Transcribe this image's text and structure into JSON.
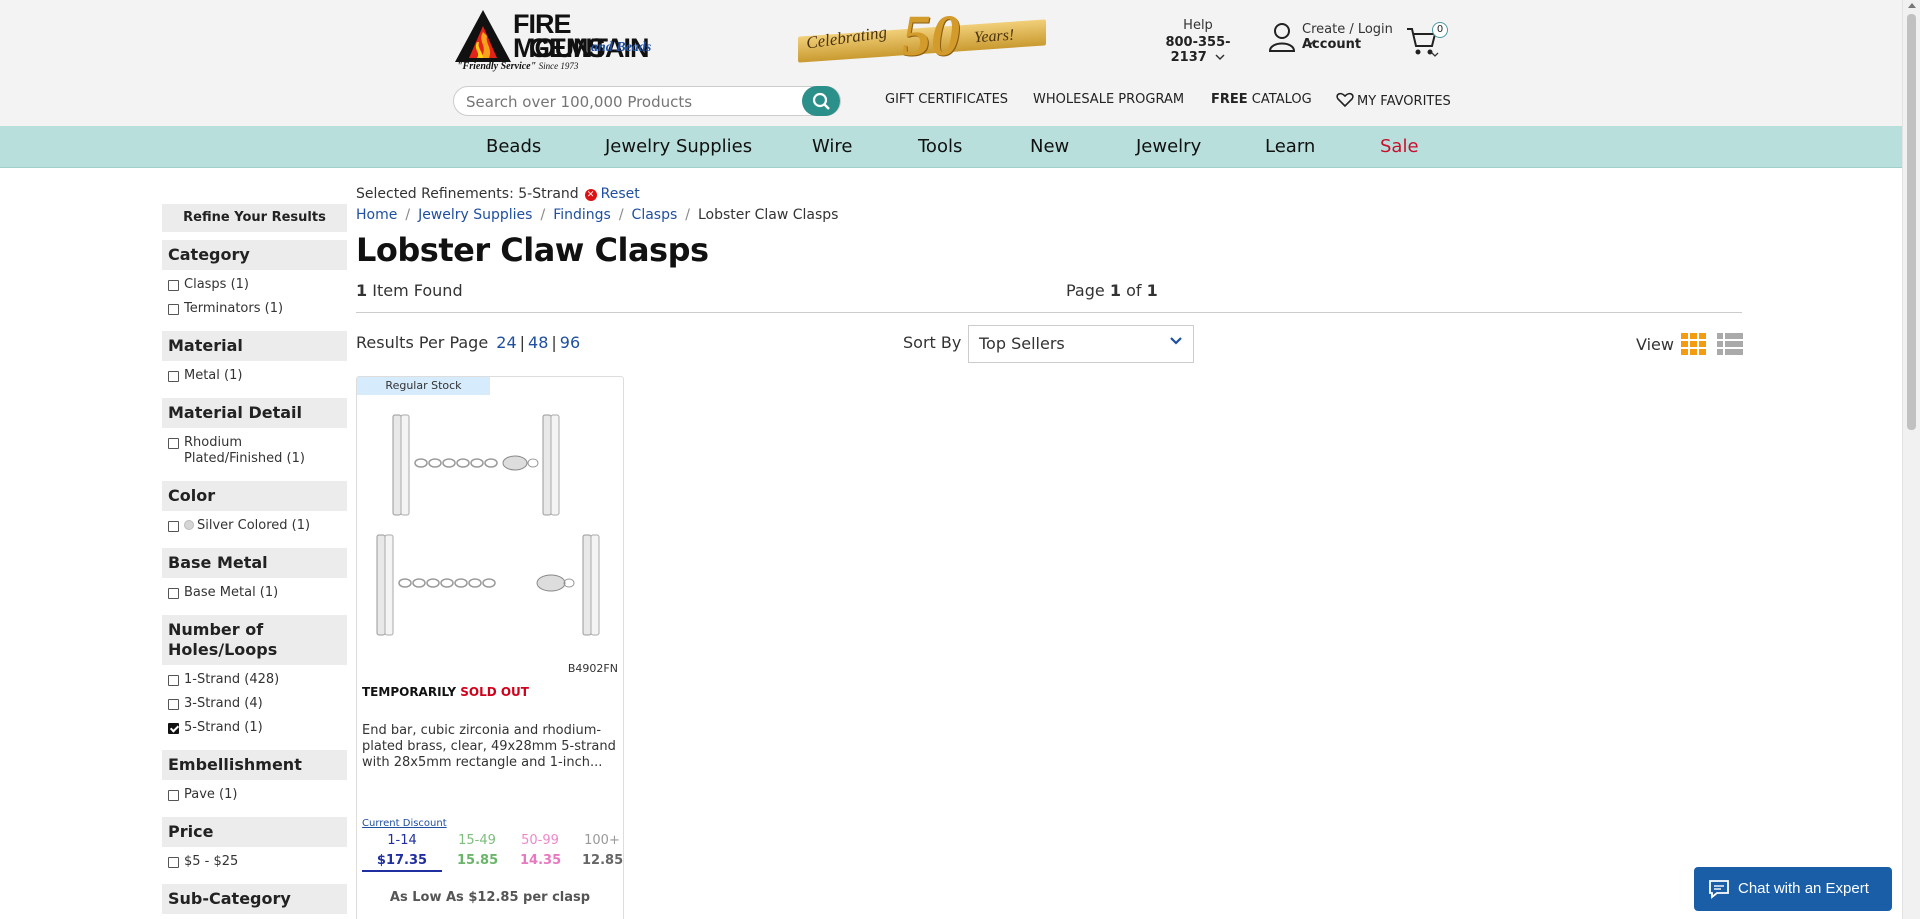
{
  "brand": {
    "name_line1": "FIRE MOUNTAIN",
    "name_line2": "GEMS",
    "name_beads": "and Beads",
    "tagline": "\"Friendly Service\"",
    "since": "Since 1973",
    "anniversary_left": "Celebrating",
    "anniversary_number": "50",
    "anniversary_right": "Years!"
  },
  "header": {
    "help_label": "Help",
    "phone": "800-355-2137",
    "account_line1": "Create / Login",
    "account_line2": "Account",
    "cart_count": "0",
    "search_placeholder": "Search over 100,000 Products",
    "links": {
      "gift": "GIFT CERTIFICATES",
      "wholesale": "WHOLESALE PROGRAM",
      "catalog_bold": "FREE",
      "catalog": "CATALOG",
      "favorites": "MY FAVORITES"
    }
  },
  "nav": [
    "Beads",
    "Jewelry Supplies",
    "Wire",
    "Tools",
    "New",
    "Jewelry",
    "Learn",
    "Sale"
  ],
  "sidebar": {
    "refine_title": "Refine Your Results",
    "facets": [
      {
        "title": "Category",
        "options": [
          {
            "label": "Clasps (1)",
            "checked": false
          },
          {
            "label": "Terminators (1)",
            "checked": false
          }
        ]
      },
      {
        "title": "Material",
        "options": [
          {
            "label": "Metal (1)",
            "checked": false
          }
        ]
      },
      {
        "title": "Material Detail",
        "options": [
          {
            "label": "Rhodium Plated/Finished (1)",
            "checked": false
          }
        ]
      },
      {
        "title": "Color",
        "options": [
          {
            "label": "Silver Colored (1)",
            "checked": false,
            "swatch": "#d5d5d5"
          }
        ]
      },
      {
        "title": "Base Metal",
        "options": [
          {
            "label": "Base Metal (1)",
            "checked": false
          }
        ]
      },
      {
        "title": "Number of Holes/Loops",
        "options": [
          {
            "label": "1-Strand (428)",
            "checked": false
          },
          {
            "label": "3-Strand (4)",
            "checked": false
          },
          {
            "label": "5-Strand (1)",
            "checked": true
          }
        ]
      },
      {
        "title": "Embellishment",
        "options": [
          {
            "label": "Pave (1)",
            "checked": false
          }
        ]
      },
      {
        "title": "Price",
        "options": [
          {
            "label": "$5 - $25",
            "checked": false
          }
        ]
      },
      {
        "title": "Sub-Category",
        "options": []
      }
    ]
  },
  "main": {
    "selected_label": "Selected Refinements:",
    "selected_value": "5-Strand",
    "reset_label": "Reset",
    "breadcrumb": [
      "Home",
      "Jewelry Supplies",
      "Findings",
      "Clasps",
      "Lobster Claw Clasps"
    ],
    "title": "Lobster Claw Clasps",
    "items_found_count": "1",
    "items_found_label": "Item Found",
    "page_label": "Page",
    "page_current": "1",
    "page_of": "of",
    "page_total": "1",
    "results_per_page_label": "Results Per Page",
    "rpp_options": [
      "24",
      "48",
      "96"
    ],
    "sort_label": "Sort By",
    "sort_value": "Top Sellers",
    "view_label": "View"
  },
  "product": {
    "stock_badge": "Regular Stock",
    "sku": "B4902FN",
    "status_prefix": "TEMPORARILY",
    "status_sold": "SOLD OUT",
    "description": "End bar, cubic zirconia and rhodium-plated brass, clear, 49x28mm 5-strand with 28x5mm rectangle and 1-inch...",
    "discount_link": "Current Discount",
    "tiers": [
      {
        "qty": "1-14",
        "price": "$17.35"
      },
      {
        "qty": "15-49",
        "price": "15.85"
      },
      {
        "qty": "50-99",
        "price": "14.35"
      },
      {
        "qty": "100+",
        "price": "12.85"
      }
    ],
    "as_low_as": "As Low As $12.85 per clasp"
  },
  "chat": {
    "label": "Chat with an Expert"
  }
}
